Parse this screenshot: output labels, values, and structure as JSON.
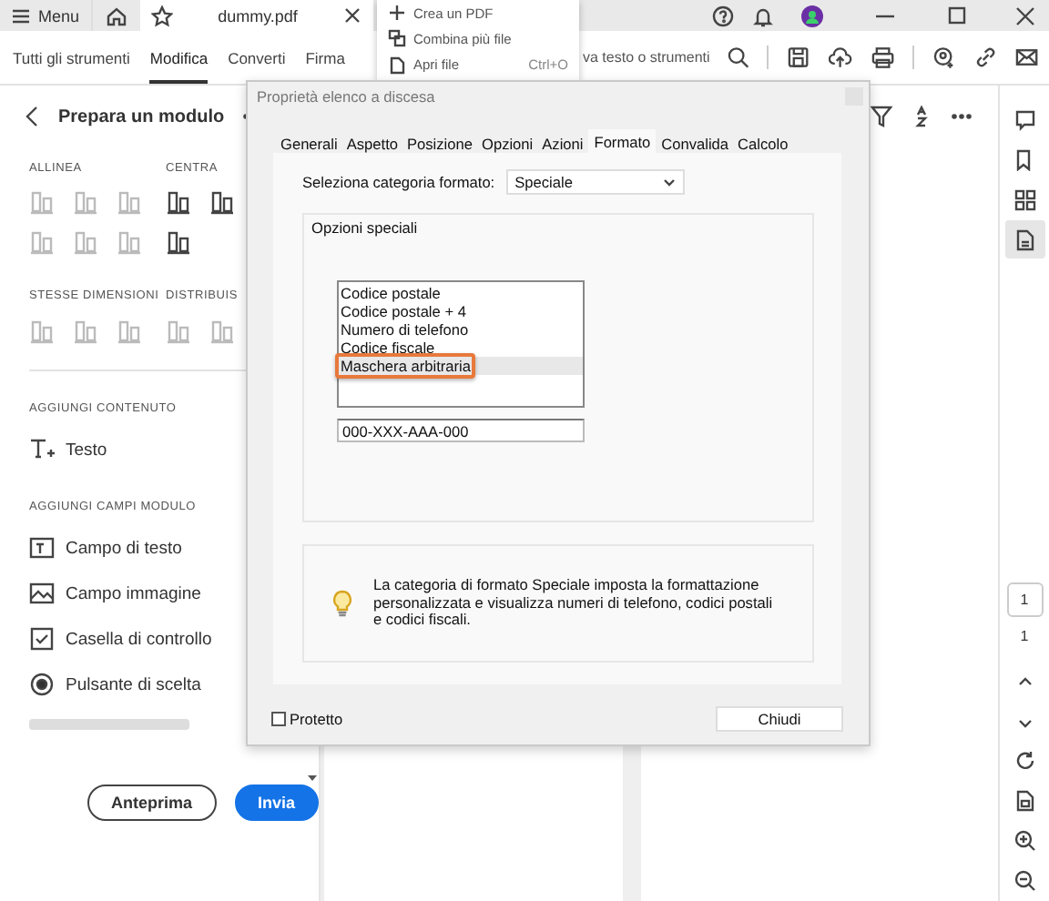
{
  "titlebar": {
    "menu": "Menu",
    "document_tab": "dummy.pdf"
  },
  "file_menu": [
    {
      "label": "Crea un PDF"
    },
    {
      "label": "Combina più file"
    },
    {
      "label": "Apri file",
      "shortcut": "Ctrl+O"
    }
  ],
  "toolbar": {
    "tabs": [
      {
        "label": "Tutti gli strumenti",
        "selected": false
      },
      {
        "label": "Modifica",
        "selected": true
      },
      {
        "label": "Converti",
        "selected": false
      },
      {
        "label": "Firma",
        "selected": false
      }
    ],
    "search": {
      "placeholder": "va testo o strumenti"
    }
  },
  "panel": {
    "title": "Prepara un modulo",
    "layout_headings": [
      "ALLINEA",
      "CENTRA",
      "STESSE DIMENSIONI",
      "DISTRIBUIS"
    ],
    "content_heading": "AGGIUNGI CONTENUTO",
    "content_items": [
      {
        "label": "Testo",
        "kind": "text"
      }
    ],
    "fields_heading": "AGGIUNGI CAMPI MODULO",
    "field_items": [
      {
        "label": "Campo di testo",
        "kind": "textfield"
      },
      {
        "label": "Campo immagine",
        "kind": "image"
      },
      {
        "label": "Casella di controllo",
        "kind": "checkbox"
      },
      {
        "label": "Pulsante di scelta",
        "kind": "radio"
      }
    ],
    "buttons": [
      {
        "label": "Anteprima",
        "kind": "outline"
      },
      {
        "label": "Invia",
        "kind": "primary"
      }
    ]
  },
  "rail": {
    "page": "1",
    "total": "1"
  },
  "dialog": {
    "title": "Proprietà elenco a discesa",
    "tabs": [
      {
        "label": "Generali",
        "selected": false
      },
      {
        "label": "Aspetto",
        "selected": false
      },
      {
        "label": "Posizione",
        "selected": false
      },
      {
        "label": "Opzioni",
        "selected": false
      },
      {
        "label": "Azioni",
        "selected": false
      },
      {
        "label": "Formato",
        "selected": true
      },
      {
        "label": "Convalida",
        "selected": false
      },
      {
        "label": "Calcolo",
        "selected": false
      }
    ],
    "category_label": "Seleziona categoria formato:",
    "category_value": "Speciale",
    "group_title": "Opzioni speciali",
    "options": [
      {
        "label": "Codice postale",
        "selected": false,
        "highlighted": false
      },
      {
        "label": "Codice postale + 4",
        "selected": false,
        "highlighted": false
      },
      {
        "label": "Numero di telefono",
        "selected": false,
        "highlighted": false
      },
      {
        "label": "Codice fiscale",
        "selected": false,
        "highlighted": false
      },
      {
        "label": "Maschera arbitraria",
        "selected": true,
        "highlighted": true
      }
    ],
    "mask_value": "000-XXX-AAA-000",
    "info": "La categoria di formato Speciale imposta la formattazione personalizzata e visualizza numeri di telefono, codici postali e codici fiscali.",
    "protected": {
      "label": "Protetto",
      "checked": false
    },
    "close_button": "Chiudi"
  }
}
